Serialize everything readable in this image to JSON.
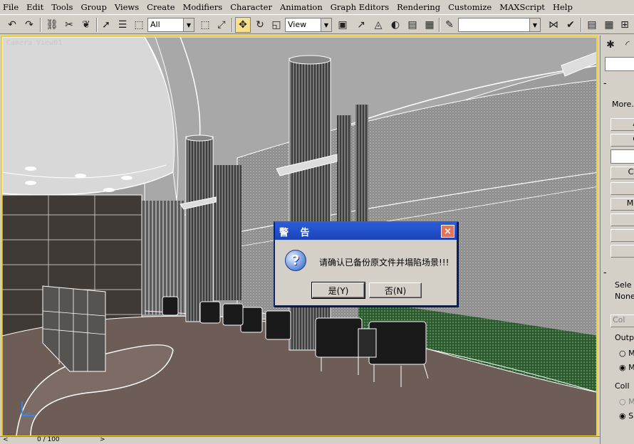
{
  "menu": [
    "File",
    "Edit",
    "Tools",
    "Group",
    "Views",
    "Create",
    "Modifiers",
    "Character",
    "Animation",
    "Graph Editors",
    "Rendering",
    "Customize",
    "MAXScript",
    "Help"
  ],
  "toolbar": {
    "selection_filter": "All",
    "ref_coord": "View",
    "named_selection": ""
  },
  "viewport": {
    "label": "Camera View01"
  },
  "command_panel": {
    "more_label": "More.",
    "btn_a": "A",
    "btn_c": "C",
    "btn_co": "Co",
    "btn_mo": "Mo",
    "sele_label": "Sele",
    "none_label": "None",
    "col_btn": "Col",
    "output_label": "Outp",
    "opt_m1": "M",
    "opt_m2": "M",
    "coll_label": "Coll",
    "opt_m3": "M",
    "opt_s": "S"
  },
  "timeline": {
    "frame": "0 / 100"
  },
  "dialog": {
    "title": "警 告",
    "message": "请确认已备份原文件并塌陷场景!!!",
    "yes": "是(Y)",
    "no": "否(N)",
    "close": "×",
    "icon": "question-icon"
  }
}
